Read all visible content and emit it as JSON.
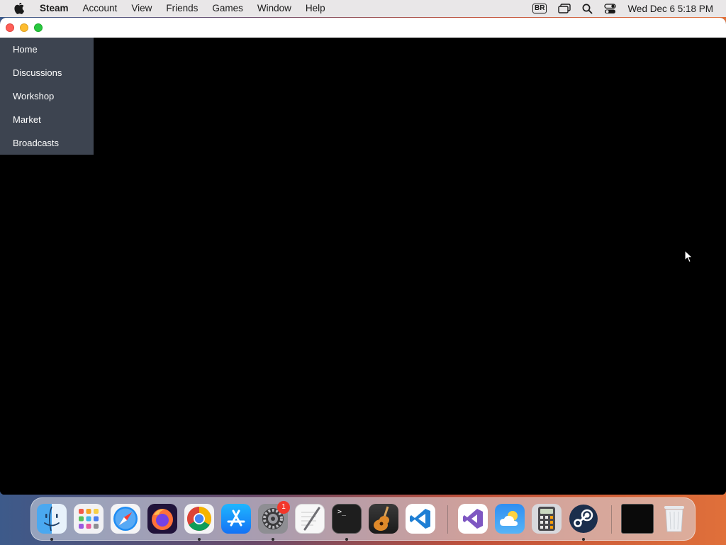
{
  "menubar": {
    "app_name": "Steam",
    "items": [
      "Account",
      "View",
      "Friends",
      "Games",
      "Window",
      "Help"
    ],
    "input_source": "BR",
    "clock": "Wed Dec 6  5:18 PM"
  },
  "window": {
    "side_menu": [
      "Home",
      "Discussions",
      "Workshop",
      "Market",
      "Broadcasts"
    ]
  },
  "dock": {
    "apps": [
      {
        "name": "Finder",
        "icon": "finder-icon",
        "running": true
      },
      {
        "name": "Launchpad",
        "icon": "launchpad-icon",
        "running": false
      },
      {
        "name": "Safari",
        "icon": "safari-icon",
        "running": false
      },
      {
        "name": "Firefox",
        "icon": "firefox-icon",
        "running": false
      },
      {
        "name": "Chrome",
        "icon": "chrome-icon",
        "running": true
      },
      {
        "name": "App Store",
        "icon": "app-store-icon",
        "running": false
      },
      {
        "name": "System Settings",
        "icon": "settings-icon",
        "running": true
      },
      {
        "name": "TextEdit",
        "icon": "textedit-icon",
        "running": false
      },
      {
        "name": "Terminal",
        "icon": "terminal-icon",
        "running": true
      },
      {
        "name": "GarageBand",
        "icon": "garageband-icon",
        "running": false
      },
      {
        "name": "Visual Studio Code",
        "icon": "vscode-icon",
        "running": false
      },
      {
        "name": "Visual Studio",
        "icon": "visual-studio-icon",
        "running": false
      },
      {
        "name": "Weather",
        "icon": "weather-icon",
        "running": false
      },
      {
        "name": "Calculator",
        "icon": "calculator-icon",
        "running": false
      },
      {
        "name": "Steam",
        "icon": "steam-icon",
        "running": true
      }
    ],
    "settings_badge": "1",
    "terminal_prompt": ">_"
  },
  "colors": {
    "menubar_bg": "#e9e7e8",
    "side_menu_bg": "#3d4450",
    "window_bg": "#000000",
    "badge": "#f2372b"
  }
}
